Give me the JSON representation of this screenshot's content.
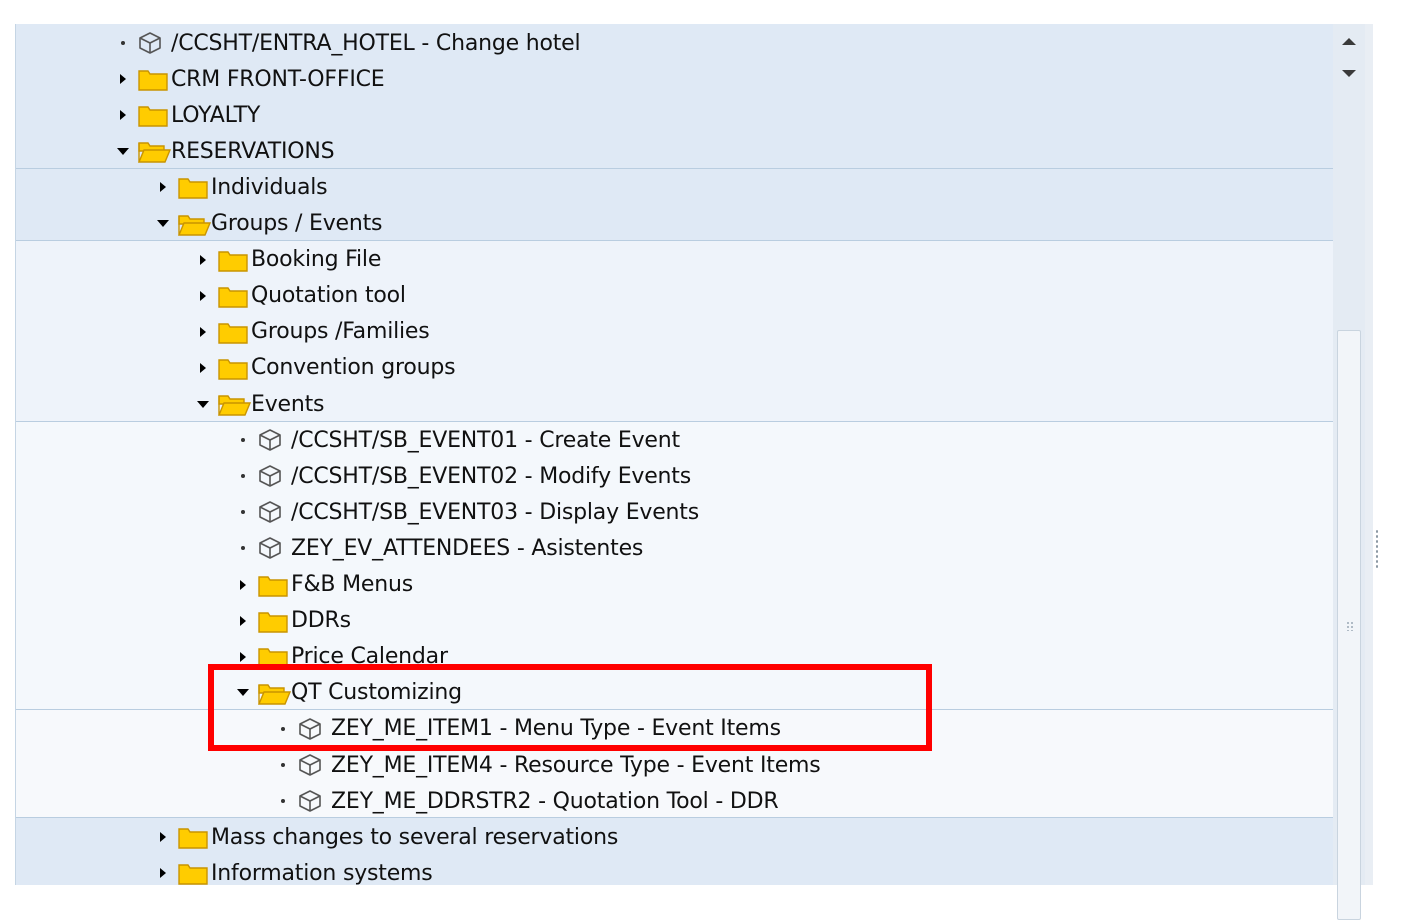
{
  "tree": {
    "rows": [
      {
        "level": 0,
        "type": "transaction",
        "label": "/CCSHT/ENTRA_HOTEL - Change hotel"
      },
      {
        "level": 0,
        "type": "folder",
        "expanded": false,
        "label": "CRM FRONT-OFFICE"
      },
      {
        "level": 0,
        "type": "folder",
        "expanded": false,
        "label": "LOYALTY"
      },
      {
        "level": 0,
        "type": "folder",
        "expanded": true,
        "label": "RESERVATIONS"
      },
      {
        "level": 1,
        "type": "folder",
        "expanded": false,
        "label": "Individuals"
      },
      {
        "level": 1,
        "type": "folder",
        "expanded": true,
        "label": "Groups / Events"
      },
      {
        "level": 2,
        "type": "folder",
        "expanded": false,
        "label": "Booking File"
      },
      {
        "level": 2,
        "type": "folder",
        "expanded": false,
        "label": "Quotation tool"
      },
      {
        "level": 2,
        "type": "folder",
        "expanded": false,
        "label": "Groups /Families"
      },
      {
        "level": 2,
        "type": "folder",
        "expanded": false,
        "label": "Convention groups"
      },
      {
        "level": 2,
        "type": "folder",
        "expanded": true,
        "label": "Events"
      },
      {
        "level": 3,
        "type": "transaction",
        "label": "/CCSHT/SB_EVENT01 - Create Event"
      },
      {
        "level": 3,
        "type": "transaction",
        "label": "/CCSHT/SB_EVENT02 - Modify Events"
      },
      {
        "level": 3,
        "type": "transaction",
        "label": "/CCSHT/SB_EVENT03 - Display Events"
      },
      {
        "level": 3,
        "type": "transaction",
        "label": "ZEY_EV_ATTENDEES - Asistentes"
      },
      {
        "level": 3,
        "type": "folder",
        "expanded": false,
        "label": "F&B Menus"
      },
      {
        "level": 3,
        "type": "folder",
        "expanded": false,
        "label": "DDRs"
      },
      {
        "level": 3,
        "type": "folder",
        "expanded": false,
        "label": "Price Calendar"
      },
      {
        "level": 3,
        "type": "folder",
        "expanded": true,
        "label": "QT Customizing"
      },
      {
        "level": 4,
        "type": "transaction",
        "label": "ZEY_ME_ITEM1 - Menu Type - Event Items"
      },
      {
        "level": 4,
        "type": "transaction",
        "label": "ZEY_ME_ITEM4 - Resource Type - Event Items"
      },
      {
        "level": 4,
        "type": "transaction",
        "label": "ZEY_ME_DDRSTR2 - Quotation Tool - DDR"
      },
      {
        "level": 1,
        "type": "folder",
        "expanded": false,
        "label": "Mass changes to several reservations"
      },
      {
        "level": 1,
        "type": "folder",
        "expanded": false,
        "label": "Information systems"
      }
    ]
  },
  "colors": {
    "folder_fill": "#ffcc00",
    "folder_edge": "#c99400",
    "highlight": "#ff0000"
  },
  "icons": {
    "transaction": "cube-icon",
    "folder_closed": "folder-icon",
    "folder_open": "folder-open-icon",
    "collapsed": "triangle-right-icon",
    "expanded": "triangle-down-icon",
    "leaf": "bullet-icon"
  }
}
